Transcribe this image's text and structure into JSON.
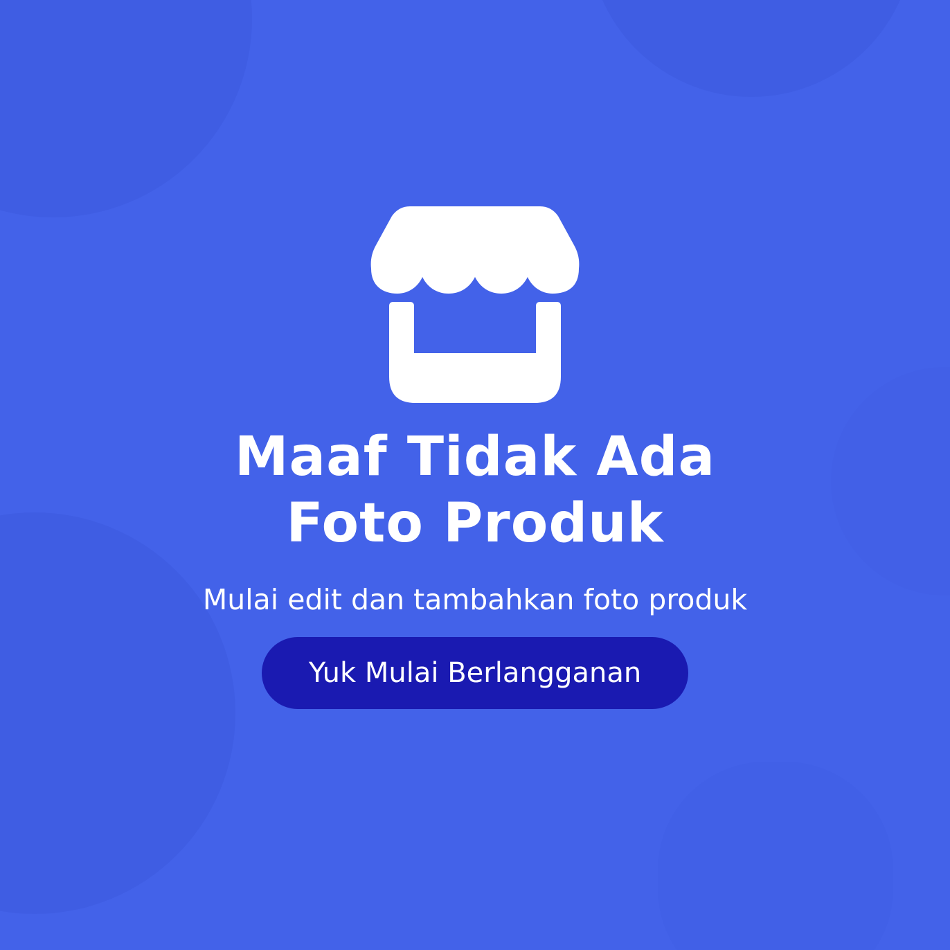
{
  "empty_state": {
    "icon": "store-icon",
    "title_line1": "Maaf Tidak Ada",
    "title_line2": "Foto Produk",
    "subtitle": "Mulai edit dan tambahkan foto produk",
    "cta_label": "Yuk Mulai Berlangganan"
  },
  "colors": {
    "background": "#4362e9",
    "background_blob": "#3f5de3",
    "text": "#ffffff",
    "button": "#1a1ab1"
  }
}
